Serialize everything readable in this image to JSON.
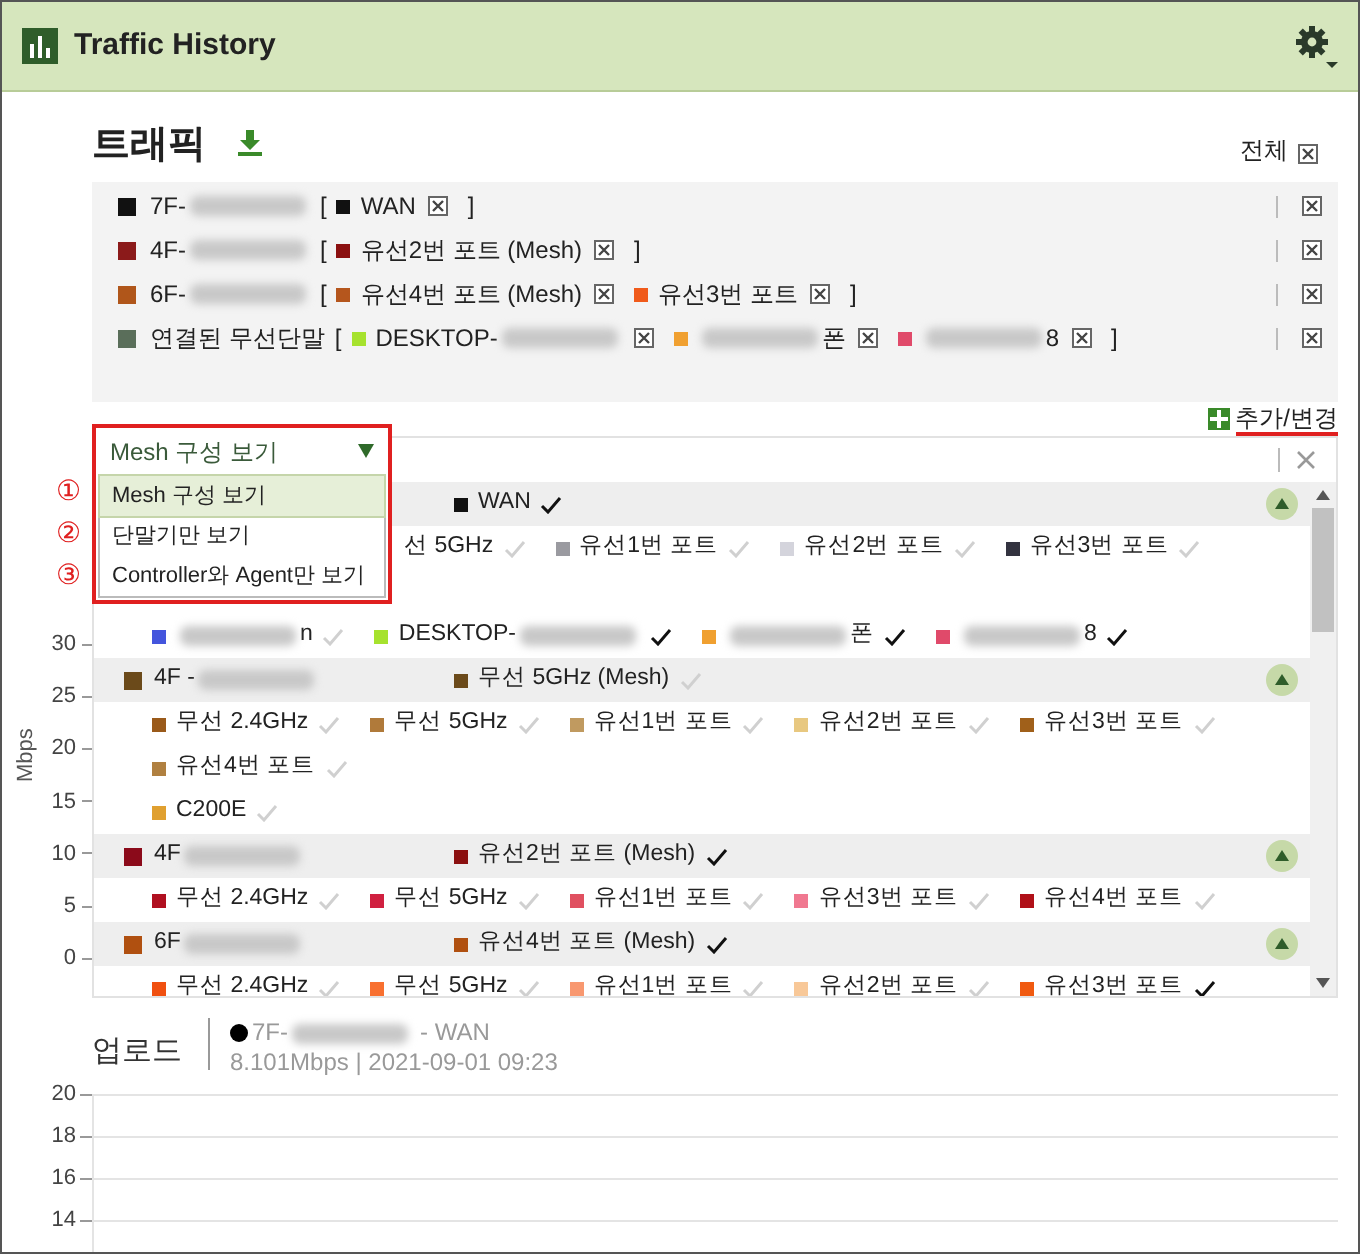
{
  "window": {
    "title": "Traffic History"
  },
  "traffic": {
    "title": "트래픽",
    "clear_all": "전체",
    "selections": [
      {
        "color": "#111111",
        "label": "7F-",
        "redacted": true,
        "open": "[",
        "close": "]",
        "links": [
          {
            "color": "#111111",
            "label": "WAN"
          }
        ]
      },
      {
        "color": "#8b1a1a",
        "label": "4F-",
        "redacted": true,
        "open": "[",
        "close": "]",
        "links": [
          {
            "color": "#8b1010",
            "label": "유선2번 포트 (Mesh)"
          }
        ]
      },
      {
        "color": "#b0561a",
        "label": "6F-",
        "redacted": true,
        "open": "[",
        "close": "]",
        "links": [
          {
            "color": "#b5561d",
            "label": "유선4번 포트 (Mesh)"
          },
          {
            "color": "#f05a1a",
            "label": "유선3번 포트"
          }
        ]
      },
      {
        "color": "#5a6e5a",
        "label": "연결된 무선단말",
        "open": "[",
        "close": "]",
        "links": [
          {
            "color": "#a6e22e",
            "label": "DESKTOP-",
            "redacted": true
          },
          {
            "color": "#f0a030",
            "label": "폰",
            "redacted": true,
            "blur_first": true
          },
          {
            "color": "#e04a6a",
            "label": "8",
            "redacted": true,
            "blur_first": true
          }
        ]
      }
    ],
    "add_change": "추가/변경"
  },
  "view_dropdown": {
    "value": "Mesh 구성 보기",
    "options": [
      {
        "label": "Mesh 구성 보기",
        "marker": "①",
        "selected": true
      },
      {
        "label": "단말기만 보기",
        "marker": "②",
        "selected": false
      },
      {
        "label": "Controller와 Agent만 보기",
        "marker": "③",
        "selected": false
      }
    ]
  },
  "download_axis": {
    "ylabel": "Mbps",
    "ticks": [
      "30",
      "25",
      "20",
      "15",
      "10",
      "5",
      "0"
    ]
  },
  "groups": [
    {
      "expanded": true,
      "mesh": {
        "color": "#111111",
        "label": "WAN",
        "checked": true
      },
      "lines": [
        {
          "items": [
            {
              "kind": "partial",
              "label": "선 5GHz",
              "checked": false
            },
            {
              "kind": "item",
              "color": "#9a9aa0",
              "label": "유선1번 포트",
              "checked": false
            },
            {
              "kind": "item",
              "color": "#d4d4dc",
              "label": "유선2번 포트",
              "checked": false
            },
            {
              "kind": "item",
              "color": "#333340",
              "label": "유선3번 포트",
              "checked": false
            }
          ]
        },
        {
          "items": [
            {
              "kind": "item",
              "color": "#4455dd",
              "label": "n",
              "redacted": true,
              "blur_first": true,
              "checked": false
            },
            {
              "kind": "item",
              "color": "#a6e22e",
              "label": "DESKTOP-",
              "redacted": true,
              "checked": true
            },
            {
              "kind": "item",
              "color": "#f0a030",
              "label": "폰",
              "redacted": true,
              "blur_first": true,
              "checked": true
            },
            {
              "kind": "item",
              "color": "#e04a6a",
              "label": "8",
              "redacted": true,
              "blur_first": true,
              "checked": true
            }
          ]
        }
      ]
    },
    {
      "label": "4F -",
      "redacted": true,
      "color": "#6b4a1a",
      "expanded": true,
      "mesh": {
        "color": "#6b4a1a",
        "label": "무선 5GHz (Mesh)",
        "checked": false
      },
      "lines": [
        {
          "items": [
            {
              "kind": "item",
              "color": "#9a5a1a",
              "label": "무선 2.4GHz",
              "checked": false
            },
            {
              "kind": "item",
              "color": "#b07a3a",
              "label": "무선 5GHz",
              "checked": false
            },
            {
              "kind": "item",
              "color": "#c09a60",
              "label": "유선1번 포트",
              "checked": false
            },
            {
              "kind": "item",
              "color": "#e8c880",
              "label": "유선2번 포트",
              "checked": false
            },
            {
              "kind": "item",
              "color": "#a0601a",
              "label": "유선3번 포트",
              "checked": false
            }
          ]
        },
        {
          "items": [
            {
              "kind": "item",
              "color": "#b08040",
              "label": "유선4번 포트",
              "checked": false
            }
          ]
        },
        {
          "items": [
            {
              "kind": "item",
              "color": "#e0a030",
              "label": "C200E",
              "checked": false
            }
          ]
        }
      ]
    },
    {
      "label": "4F",
      "redacted": true,
      "color": "#8b0a1a",
      "expanded": true,
      "mesh": {
        "color": "#8b1010",
        "label": "유선2번 포트 (Mesh)",
        "checked": true
      },
      "lines": [
        {
          "items": [
            {
              "kind": "item",
              "color": "#b01020",
              "label": "무선 2.4GHz",
              "checked": false
            },
            {
              "kind": "item",
              "color": "#d02040",
              "label": "무선 5GHz",
              "checked": false
            },
            {
              "kind": "item",
              "color": "#e05060",
              "label": "유선1번 포트",
              "checked": false
            },
            {
              "kind": "item",
              "color": "#f07890",
              "label": "유선3번 포트",
              "checked": false
            },
            {
              "kind": "item",
              "color": "#b01018",
              "label": "유선4번 포트",
              "checked": false
            }
          ]
        }
      ]
    },
    {
      "label": "6F",
      "redacted": true,
      "color": "#b05010",
      "expanded": true,
      "mesh": {
        "color": "#b05010",
        "label": "유선4번 포트 (Mesh)",
        "checked": true
      },
      "lines": [
        {
          "items": [
            {
              "kind": "item",
              "color": "#f05010",
              "label": "무선 2.4GHz",
              "checked": false
            },
            {
              "kind": "item",
              "color": "#f87030",
              "label": "무선 5GHz",
              "checked": false
            },
            {
              "kind": "item",
              "color": "#f89870",
              "label": "유선1번 포트",
              "checked": false
            },
            {
              "kind": "item",
              "color": "#f8c898",
              "label": "유선2번 포트",
              "checked": false
            },
            {
              "kind": "item",
              "color": "#f05a10",
              "label": "유선3번 포트",
              "checked": true
            }
          ]
        }
      ]
    }
  ],
  "upload": {
    "title": "업로드",
    "legend": {
      "color": "#000000",
      "label": "7F-",
      "redacted": true,
      "suffix": "- WAN",
      "detail": "8.101Mbps | 2021-09-01 09:23"
    },
    "ticks": [
      "20",
      "18",
      "16",
      "14"
    ]
  }
}
